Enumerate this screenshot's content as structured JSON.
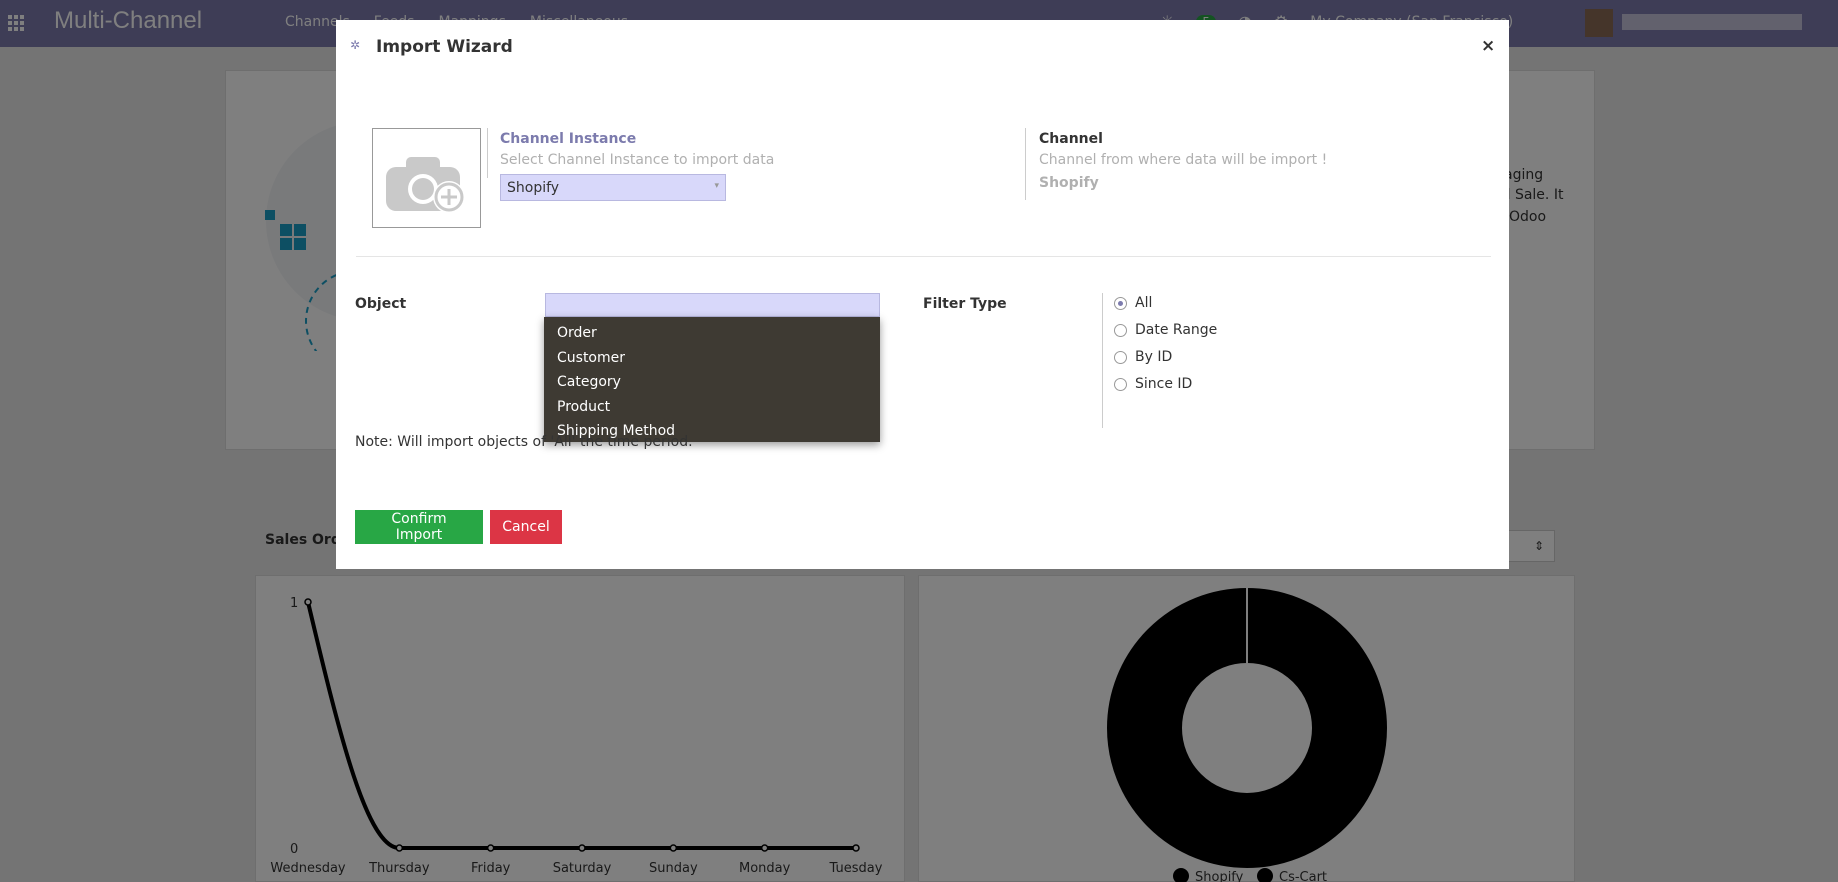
{
  "app": {
    "brand": "Multi-Channel",
    "menu": [
      "Channels",
      "Feeds",
      "Mappings",
      "Miscellaneous"
    ],
    "chat_count": "5",
    "company": "My Company (San Francisco)",
    "partial_text": [
      "aging",
      "el Sale. It",
      "Odoo"
    ]
  },
  "dashboard": {
    "sales_title": "Sales Orders",
    "line_chart": {
      "type": "line",
      "categories": [
        "Wednesday",
        "Thursday",
        "Friday",
        "Saturday",
        "Sunday",
        "Monday",
        "Tuesday"
      ],
      "values": [
        1,
        0,
        0,
        0,
        0,
        0,
        0
      ],
      "ylim": [
        0,
        1
      ],
      "y_ticks": [
        "1",
        "0"
      ]
    },
    "donut_chart": {
      "type": "pie",
      "labels": [
        "Shopify",
        "Cs-Cart"
      ],
      "values": [
        100,
        0
      ],
      "legend": "bottom"
    }
  },
  "chart_data": [
    {
      "type": "line",
      "categories": [
        "Wednesday",
        "Thursday",
        "Friday",
        "Saturday",
        "Sunday",
        "Monday",
        "Tuesday"
      ],
      "values": [
        1,
        0,
        0,
        0,
        0,
        0,
        0
      ],
      "ylim": [
        0,
        1
      ]
    },
    {
      "type": "pie",
      "categories": [
        "Shopify",
        "Cs-Cart"
      ],
      "values": [
        100,
        0
      ],
      "legend": "bottom"
    }
  ],
  "modal": {
    "title": "Import Wizard",
    "close_label": "×",
    "channel_instance": {
      "label": "Channel Instance",
      "help": "Select Channel Instance to import data",
      "value": "Shopify"
    },
    "channel": {
      "label": "Channel",
      "help": "Channel from where data will be import !",
      "value": "Shopify"
    },
    "object_label": "Object",
    "object_options": [
      "Order",
      "Customer",
      "Category",
      "Product",
      "Shipping Method"
    ],
    "filter_label": "Filter Type",
    "filter_options": [
      "All",
      "Date Range",
      "By ID",
      "Since ID"
    ],
    "filter_selected": "All",
    "note": "Note: Will import objects of 'All' the time period.",
    "confirm_label": "Confirm Import",
    "cancel_label": "Cancel"
  },
  "colors": {
    "brand": "#7c7bad",
    "confirm": "#28a745",
    "cancel": "#dc3545",
    "select_bg": "#d8d8fa"
  }
}
